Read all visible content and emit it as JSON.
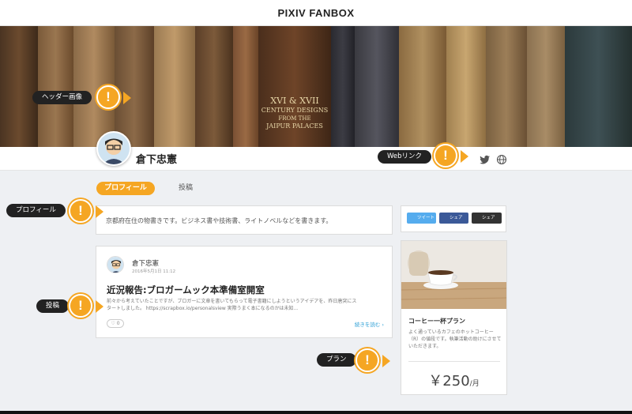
{
  "app": {
    "logo": "PIXIV FANBOX"
  },
  "creator": {
    "name": "倉下忠憲"
  },
  "header": {
    "book_texts": [
      "XVI & XVII",
      "CENTURY DESIGNS",
      "FROM THE",
      "JAIPUR PALACES"
    ]
  },
  "tabs": [
    {
      "label": "プロフィール",
      "active": true
    },
    {
      "label": "投稿",
      "active": false
    }
  ],
  "bio": {
    "text": "京都府在住の物書きです。ビジネス書や技術書、ライトノベルなどを書きます。"
  },
  "share": {
    "buttons": [
      {
        "label": "ツイート",
        "color": "#55acee"
      },
      {
        "label": "シェア",
        "color": "#3b5998"
      },
      {
        "label": "シェア",
        "color": "#333333"
      }
    ]
  },
  "post": {
    "author": "倉下忠憲",
    "date": "2016年5月1日 11:12",
    "title": "近況報告:ブロガームック本準備室開室",
    "excerpt_line1": "前々から考えていたことですが、ブロガーに文章を書いてもらって電子書籍にしようというアイデアを、昨日唐突にス",
    "excerpt_line2": "タートしました。 https://scrapbox.io/personalsview 実際うまく本になるのかは未知...",
    "likes": "0",
    "read_more": "続きを読む ›"
  },
  "plan": {
    "title": "コーヒー一杯プラン",
    "description": "よく通っているカフェのホットコーヒー（R）の値段です。執筆活動の助けにさせていただきます。",
    "price": "￥250",
    "unit": "/月"
  },
  "callouts": {
    "header_image": "ヘッダー画像",
    "web_link": "Webリンク",
    "profile": "プロフィール",
    "posts": "投稿",
    "plan": "プラン",
    "mark": "!"
  },
  "colors": {
    "accent": "#f5a623",
    "link": "#2ea0d6",
    "callout_bg": "#222222"
  },
  "icons": [
    "twitter-icon",
    "globe-icon",
    "heart-icon",
    "warning-icon"
  ]
}
